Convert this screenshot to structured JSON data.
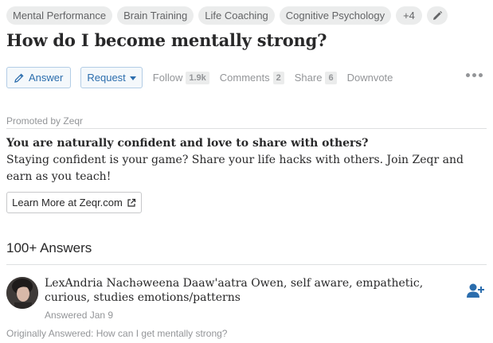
{
  "topics": [
    "Mental Performance",
    "Brain Training",
    "Life Coaching",
    "Cognitive Psychology"
  ],
  "topics_more": "+4",
  "question": {
    "title": "How do I become mentally strong?"
  },
  "actions": {
    "answer_label": "Answer",
    "request_label": "Request",
    "follow_label": "Follow",
    "follow_count": "1.9k",
    "comments_label": "Comments",
    "comments_count": "2",
    "share_label": "Share",
    "share_count": "6",
    "downvote_label": "Downvote"
  },
  "promo": {
    "label": "Promoted by Zeqr",
    "headline": "You are naturally confident and love to share with others?",
    "body": "Staying confident is your game? Share your life hacks with others. Join Zeqr and earn as you teach!",
    "cta_label": "Learn More at Zeqr.com"
  },
  "answers": {
    "count_label": "100+ Answers",
    "first": {
      "author_name": "LexAndria Nachəweena Daaw'aatra Owen,",
      "author_bio": "self aware, empathetic, curious, studies emotions/patterns",
      "answered_date": "Answered Jan 9",
      "originally_answered": "Originally Answered: How can I get mentally strong?"
    }
  },
  "colors": {
    "accent_blue": "#2b6dad",
    "muted_gray": "#939598",
    "chip_bg": "#ebecec"
  },
  "icons": [
    "pencil-icon",
    "answer-pencil-icon",
    "external-link-icon",
    "add-user-icon",
    "more-options-icon"
  ]
}
